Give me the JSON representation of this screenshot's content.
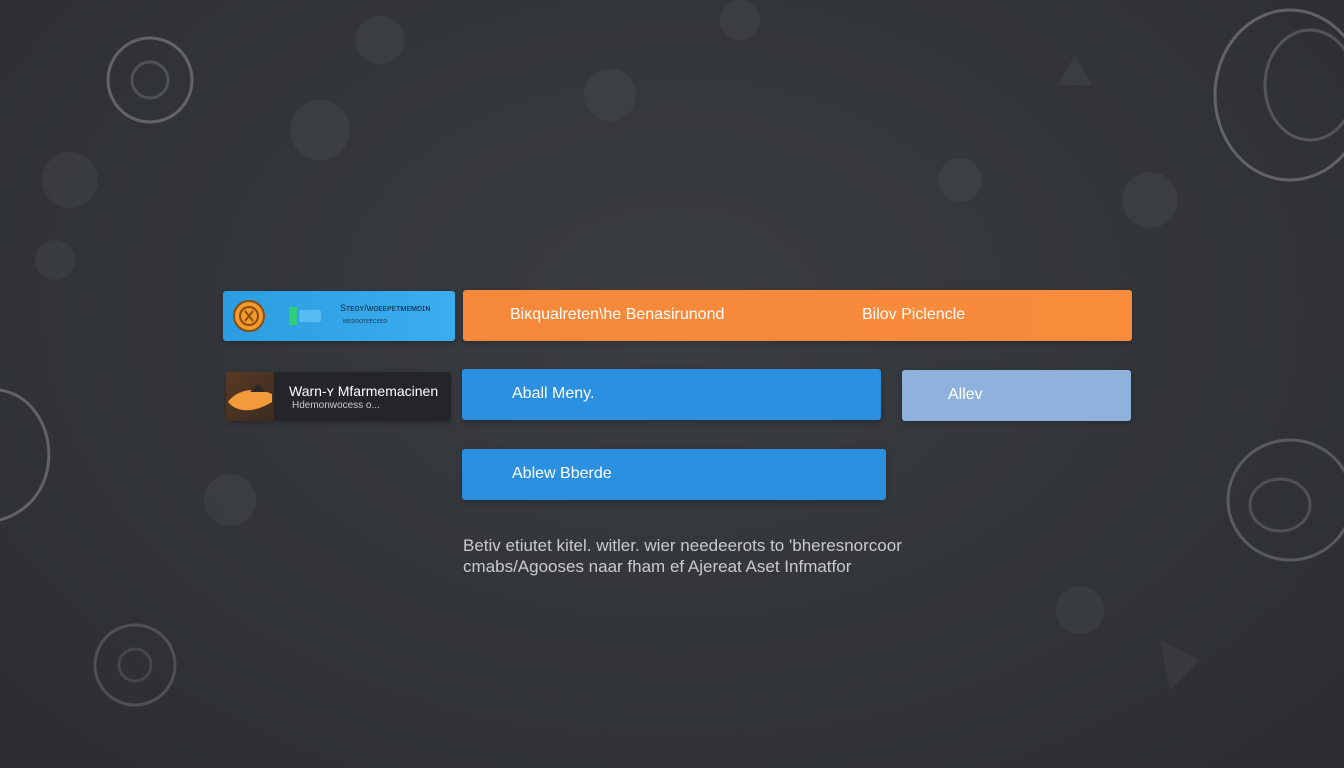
{
  "colors": {
    "background": "#33363b",
    "accent_orange": "#f98c3b",
    "accent_blue": "#2b90e0",
    "accent_light_blue": "#8fb2dc",
    "wallet_card": "#3aaef0",
    "warning_card": "#232529",
    "text_light": "#ffffff",
    "text_muted": "#c8cbcf"
  },
  "left_panel": {
    "wallet_card": {
      "icon": "coin-icon",
      "chip_icon": "card-chip-icon",
      "title": "Sᴛᴇᴏʏ/ᴡᴏᴇᴇᴘᴇᴛᴍᴇᴍᴏɪɴ",
      "subtitle": "ᴍᴇᴅᴏᴏᴛᴇᴇᴄᴇᴇᴏ"
    },
    "warning_card": {
      "icon": "warning-thumbnail-icon",
      "title": "Warn-ʏ Mfarmemacinen",
      "subtitle": "Hdemonwocess o..."
    }
  },
  "buttons": {
    "orange_bar": {
      "left_label": "Biᴋqualreten\\he Benasirunond",
      "right_label": "Bilov Piclencle"
    },
    "blue_mid": {
      "label": "Aball Meny."
    },
    "light_blue": {
      "label": "Allev"
    },
    "blue_low": {
      "label": "Ablew Bberde"
    }
  },
  "description": {
    "line1": "Betiv etiutet kitel. witler. wier needeerots to 'bheresnorcoor",
    "line2": "cmabs/Agooses naar fham ef Ajereat Aset  Infmatfor"
  }
}
